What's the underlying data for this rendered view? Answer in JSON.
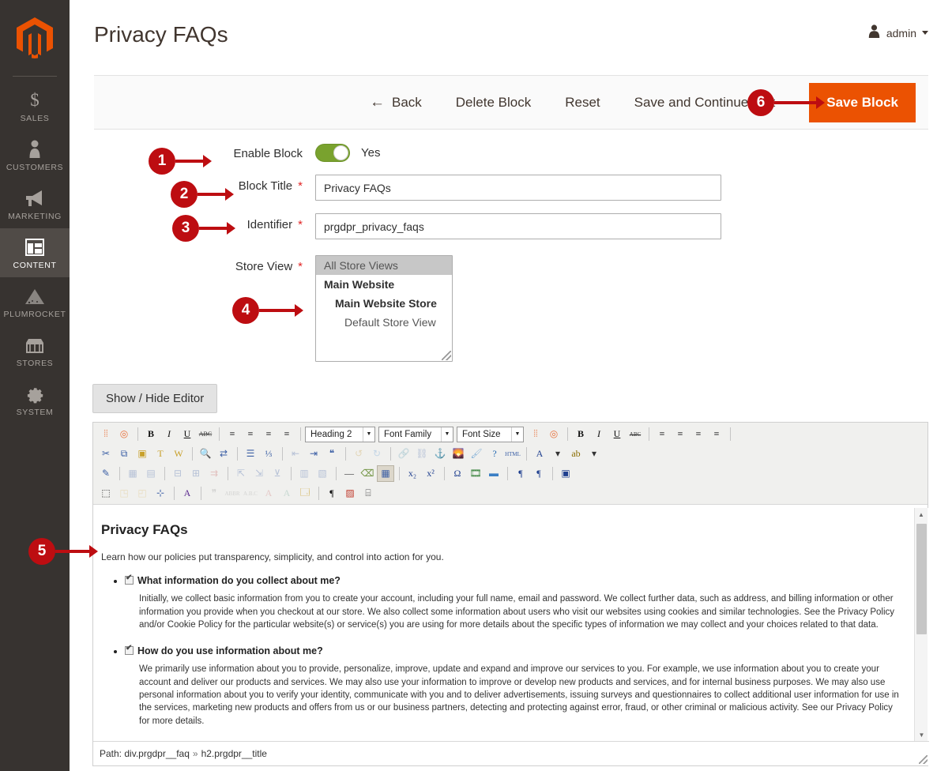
{
  "sidebar": {
    "logo_name": "magento-logo-icon",
    "items": [
      {
        "label": "SALES",
        "icon": "dollar-icon",
        "active": false
      },
      {
        "label": "CUSTOMERS",
        "icon": "person-icon",
        "active": false
      },
      {
        "label": "MARKETING",
        "icon": "megaphone-icon",
        "active": false
      },
      {
        "label": "CONTENT",
        "icon": "layout-icon",
        "active": true
      },
      {
        "label": "PLUMROCKET",
        "icon": "plumrocket-icon",
        "active": false
      },
      {
        "label": "STORES",
        "icon": "storefront-icon",
        "active": false
      },
      {
        "label": "SYSTEM",
        "icon": "gear-icon",
        "active": false
      }
    ]
  },
  "header": {
    "title": "Privacy FAQs",
    "admin_label": "admin"
  },
  "actions": {
    "back": "Back",
    "back_arrow": "←",
    "delete": "Delete Block",
    "reset": "Reset",
    "save_continue": "Save and Continue Edit",
    "save": "Save Block"
  },
  "form": {
    "enable_block": {
      "label": "Enable Block",
      "value": "Yes",
      "toggle_on": true
    },
    "block_title": {
      "label": "Block Title",
      "required": "*",
      "value": "Privacy FAQs"
    },
    "identifier": {
      "label": "Identifier",
      "required": "*",
      "value": "prgdpr_privacy_faqs"
    },
    "store_view": {
      "label": "Store View",
      "required": "*",
      "options": [
        {
          "text": "All Store Views",
          "level": 0,
          "selected": true
        },
        {
          "text": "Main Website",
          "level": 1,
          "selected": false
        },
        {
          "text": "Main Website Store",
          "level": 2,
          "selected": false
        },
        {
          "text": "Default Store View",
          "level": 3,
          "selected": false
        }
      ]
    }
  },
  "editor": {
    "show_hide_label": "Show / Hide Editor",
    "selects": [
      {
        "name": "format-select",
        "value": "Heading 2"
      },
      {
        "name": "font-family-select",
        "value": "Font Family"
      },
      {
        "name": "font-size-select",
        "value": "Font Size"
      }
    ],
    "toolbar_rows": [
      [
        {
          "n": "magento-widget-icon",
          "g": "⦙⦙",
          "c": "#e8703a",
          "dis": false
        },
        {
          "n": "magento-variable-icon",
          "g": "◎",
          "c": "#e8703a",
          "dis": false
        },
        {
          "n": "sep"
        },
        {
          "n": "bold-icon",
          "g": "B",
          "c": "#111",
          "dis": false,
          "b": true
        },
        {
          "n": "italic-icon",
          "g": "I",
          "c": "#111",
          "dis": false,
          "i": true
        },
        {
          "n": "underline-icon",
          "g": "U",
          "c": "#111",
          "dis": false,
          "u": true
        },
        {
          "n": "strikethrough-icon",
          "g": "ABC",
          "c": "#333",
          "dis": false,
          "s": true
        },
        {
          "n": "sep"
        },
        {
          "n": "align-left-icon",
          "g": "≡",
          "c": "#111",
          "dis": false
        },
        {
          "n": "align-center-icon",
          "g": "≡",
          "c": "#111",
          "dis": false
        },
        {
          "n": "align-right-icon",
          "g": "≡",
          "c": "#111",
          "dis": false
        },
        {
          "n": "align-justify-icon",
          "g": "≡",
          "c": "#111",
          "dis": false
        },
        {
          "n": "sep"
        }
      ],
      [
        {
          "n": "cut-icon",
          "g": "✂",
          "c": "#3b5fa5",
          "dis": false
        },
        {
          "n": "copy-icon",
          "g": "⧉",
          "c": "#3b5fa5",
          "dis": false
        },
        {
          "n": "paste-icon",
          "g": "▣",
          "c": "#c8a02a",
          "dis": false
        },
        {
          "n": "paste-text-icon",
          "g": "T",
          "c": "#c8a02a",
          "dis": false
        },
        {
          "n": "paste-word-icon",
          "g": "W",
          "c": "#c8a02a",
          "dis": false
        },
        {
          "n": "sep"
        },
        {
          "n": "find-icon",
          "g": "🔍",
          "c": "#3b5fa5",
          "dis": false
        },
        {
          "n": "replace-icon",
          "g": "⇄",
          "c": "#3b5fa5",
          "dis": false
        },
        {
          "n": "sep"
        },
        {
          "n": "bullet-list-icon",
          "g": "☰",
          "c": "#3b5fa5",
          "dis": false
        },
        {
          "n": "numbered-list-icon",
          "g": "⅓",
          "c": "#3b5fa5",
          "dis": false
        },
        {
          "n": "sep"
        },
        {
          "n": "outdent-icon",
          "g": "⇤",
          "c": "#3b5fa5",
          "dis": true
        },
        {
          "n": "indent-icon",
          "g": "⇥",
          "c": "#3b5fa5",
          "dis": false
        },
        {
          "n": "blockquote-icon",
          "g": "❝",
          "c": "#3b5fa5",
          "dis": false
        },
        {
          "n": "sep"
        },
        {
          "n": "undo-icon",
          "g": "↺",
          "c": "#c9a24a",
          "dis": true
        },
        {
          "n": "redo-icon",
          "g": "↻",
          "c": "#6aa0d8",
          "dis": true
        },
        {
          "n": "sep"
        },
        {
          "n": "link-icon",
          "g": "🔗",
          "c": "#3b5fa5",
          "dis": true
        },
        {
          "n": "unlink-icon",
          "g": "⛓",
          "c": "#3b5fa5",
          "dis": true
        },
        {
          "n": "anchor-icon",
          "g": "⚓",
          "c": "#1f3f8f",
          "dis": false
        },
        {
          "n": "image-icon",
          "g": "🌄",
          "c": "#2e7d32",
          "dis": false
        },
        {
          "n": "cleanup-icon",
          "g": "🖌",
          "c": "#8ab4d8",
          "dis": false
        },
        {
          "n": "help-icon",
          "g": "?",
          "c": "#1f66b0",
          "dis": false
        },
        {
          "n": "html-source-icon",
          "g": "HTML",
          "c": "#3b5fa5",
          "dis": false
        },
        {
          "n": "sep"
        },
        {
          "n": "text-color-icon",
          "g": "A",
          "c": "#1f3f8f",
          "dis": false
        },
        {
          "n": "text-color-dropdown-icon",
          "g": "▾",
          "c": "#333",
          "dis": false
        },
        {
          "n": "background-color-icon",
          "g": "ab",
          "c": "#8a6d00",
          "dis": false
        },
        {
          "n": "background-color-dropdown-icon",
          "g": "▾",
          "c": "#333",
          "dis": false
        }
      ],
      [
        {
          "n": "edit-css-icon",
          "g": "✎",
          "c": "#3b5fa5",
          "dis": false
        },
        {
          "n": "sep"
        },
        {
          "n": "insert-table-icon",
          "g": "▦",
          "c": "#3b5fa5",
          "dis": true
        },
        {
          "n": "table-props-icon",
          "g": "▤",
          "c": "#3b5fa5",
          "dis": true
        },
        {
          "n": "sep"
        },
        {
          "n": "row-props-icon",
          "g": "⊟",
          "c": "#3b5fa5",
          "dis": true
        },
        {
          "n": "cell-props-icon",
          "g": "⊞",
          "c": "#3b5fa5",
          "dis": true
        },
        {
          "n": "insert-row-icon",
          "g": "⇉",
          "c": "#c56060",
          "dis": true
        },
        {
          "n": "sep"
        },
        {
          "n": "insert-col-before-icon",
          "g": "⇱",
          "c": "#3b5fa5",
          "dis": true
        },
        {
          "n": "insert-col-after-icon",
          "g": "⇲",
          "c": "#3b5fa5",
          "dis": true
        },
        {
          "n": "delete-col-icon",
          "g": "⊻",
          "c": "#3b5fa5",
          "dis": true
        },
        {
          "n": "sep"
        },
        {
          "n": "split-cells-icon",
          "g": "▥",
          "c": "#3b5fa5",
          "dis": true
        },
        {
          "n": "merge-cells-icon",
          "g": "▧",
          "c": "#3b5fa5",
          "dis": true
        },
        {
          "n": "sep"
        },
        {
          "n": "horizontal-rule-icon",
          "g": "—",
          "c": "#333",
          "dis": false
        },
        {
          "n": "remove-format-icon",
          "g": "⌫",
          "c": "#6b8f3a",
          "dis": false
        },
        {
          "n": "visual-aid-icon",
          "g": "▦",
          "c": "#3b5fa5",
          "dis": false,
          "on": true
        },
        {
          "n": "sep"
        },
        {
          "n": "subscript-icon",
          "g": "x₂",
          "c": "#1f3f8f",
          "dis": false
        },
        {
          "n": "superscript-icon",
          "g": "x²",
          "c": "#1f3f8f",
          "dis": false
        },
        {
          "n": "sep"
        },
        {
          "n": "special-char-icon",
          "g": "Ω",
          "c": "#1f3f8f",
          "dis": false
        },
        {
          "n": "media-icon",
          "g": "🎞",
          "c": "#2e7d32",
          "dis": false
        },
        {
          "n": "page-break-icon",
          "g": "▬",
          "c": "#3b7fc4",
          "dis": false
        },
        {
          "n": "sep"
        },
        {
          "n": "ltr-icon",
          "g": "¶",
          "c": "#1f3f8f",
          "dis": false
        },
        {
          "n": "rtl-icon",
          "g": "¶",
          "c": "#1f3f8f",
          "dis": false
        },
        {
          "n": "sep"
        },
        {
          "n": "insert-layer-icon",
          "g": "▣",
          "c": "#1f3f8f",
          "dis": false
        }
      ],
      [
        {
          "n": "select-all-icon",
          "g": "⬚",
          "c": "#333",
          "dis": false
        },
        {
          "n": "move-forward-icon",
          "g": "◳",
          "c": "#d8b35a",
          "dis": true
        },
        {
          "n": "move-backward-icon",
          "g": "◰",
          "c": "#d8b35a",
          "dis": true
        },
        {
          "n": "insert-layer2-icon",
          "g": "⊹",
          "c": "#3b5fa5",
          "dis": false
        },
        {
          "n": "sep"
        },
        {
          "n": "styleprops-icon",
          "g": "A",
          "c": "#5b2a8f",
          "dis": false
        },
        {
          "n": "sep"
        },
        {
          "n": "citation-icon",
          "g": "❞",
          "c": "#999",
          "dis": true
        },
        {
          "n": "abbreviation-icon",
          "g": "ABBR",
          "c": "#999",
          "dis": true
        },
        {
          "n": "acronym-icon",
          "g": "A.B.C",
          "c": "#999",
          "dis": true
        },
        {
          "n": "deletion-icon",
          "g": "A",
          "c": "#c77",
          "dis": true
        },
        {
          "n": "insertion-icon",
          "g": "A",
          "c": "#7a9",
          "dis": true
        },
        {
          "n": "attributes-icon",
          "g": "🗔",
          "c": "#c8a02a",
          "dis": false
        },
        {
          "n": "sep"
        },
        {
          "n": "show-blocks-icon",
          "g": "¶",
          "c": "#111",
          "dis": false
        },
        {
          "n": "nonbreaking-icon",
          "g": "▨",
          "c": "#c0392b",
          "dis": false
        },
        {
          "n": "toolbar-toggle-icon",
          "g": "⌸",
          "c": "#555",
          "dis": false
        }
      ]
    ],
    "content": {
      "heading": "Privacy FAQs",
      "intro": "Learn how our policies put transparency, simplicity, and control into action for you.",
      "faqs": [
        {
          "question": "What information do you collect about me?",
          "answer": "Initially, we collect basic information from you to create your account, including your full name, email and password. We collect further data, such as address, and billing information or other information you provide when you checkout at our store. We also collect some information about users who visit our websites using cookies and similar technologies. See the Privacy Policy and/or Cookie Policy for the particular website(s) or service(s) you are using for more details about the specific types of information we may collect and your choices related to that data."
        },
        {
          "question": "How do you use information about me?",
          "answer": "We primarily use information about you to provide, personalize, improve, update and expand and improve our services to you. For example, we use information about you to create your account and deliver our products and services. We may also use your information to improve or develop new products and services, and for internal business purposes. We may also use personal information about you to verify your identity, communicate with you and to deliver advertisements, issuing surveys and questionnaires to collect additional user information for use in the services, marketing new products and offers from us or our business partners, detecting and protecting against error, fraud, or other criminal or malicious activity. See our Privacy Policy for more details."
        }
      ]
    },
    "status_path_prefix": "Path:",
    "status_path_part1": "div.prgdpr__faq",
    "status_path_sep": "»",
    "status_path_part2": "h2.prgdpr__title"
  },
  "callouts": [
    {
      "num": "1"
    },
    {
      "num": "2"
    },
    {
      "num": "3"
    },
    {
      "num": "4"
    },
    {
      "num": "5"
    },
    {
      "num": "6"
    }
  ],
  "colors": {
    "brand_orange": "#eb5202",
    "callout_red": "#bd0d11",
    "sidebar_dark": "#373330",
    "toggle_green": "#79a22e",
    "required_red": "#e22626"
  }
}
